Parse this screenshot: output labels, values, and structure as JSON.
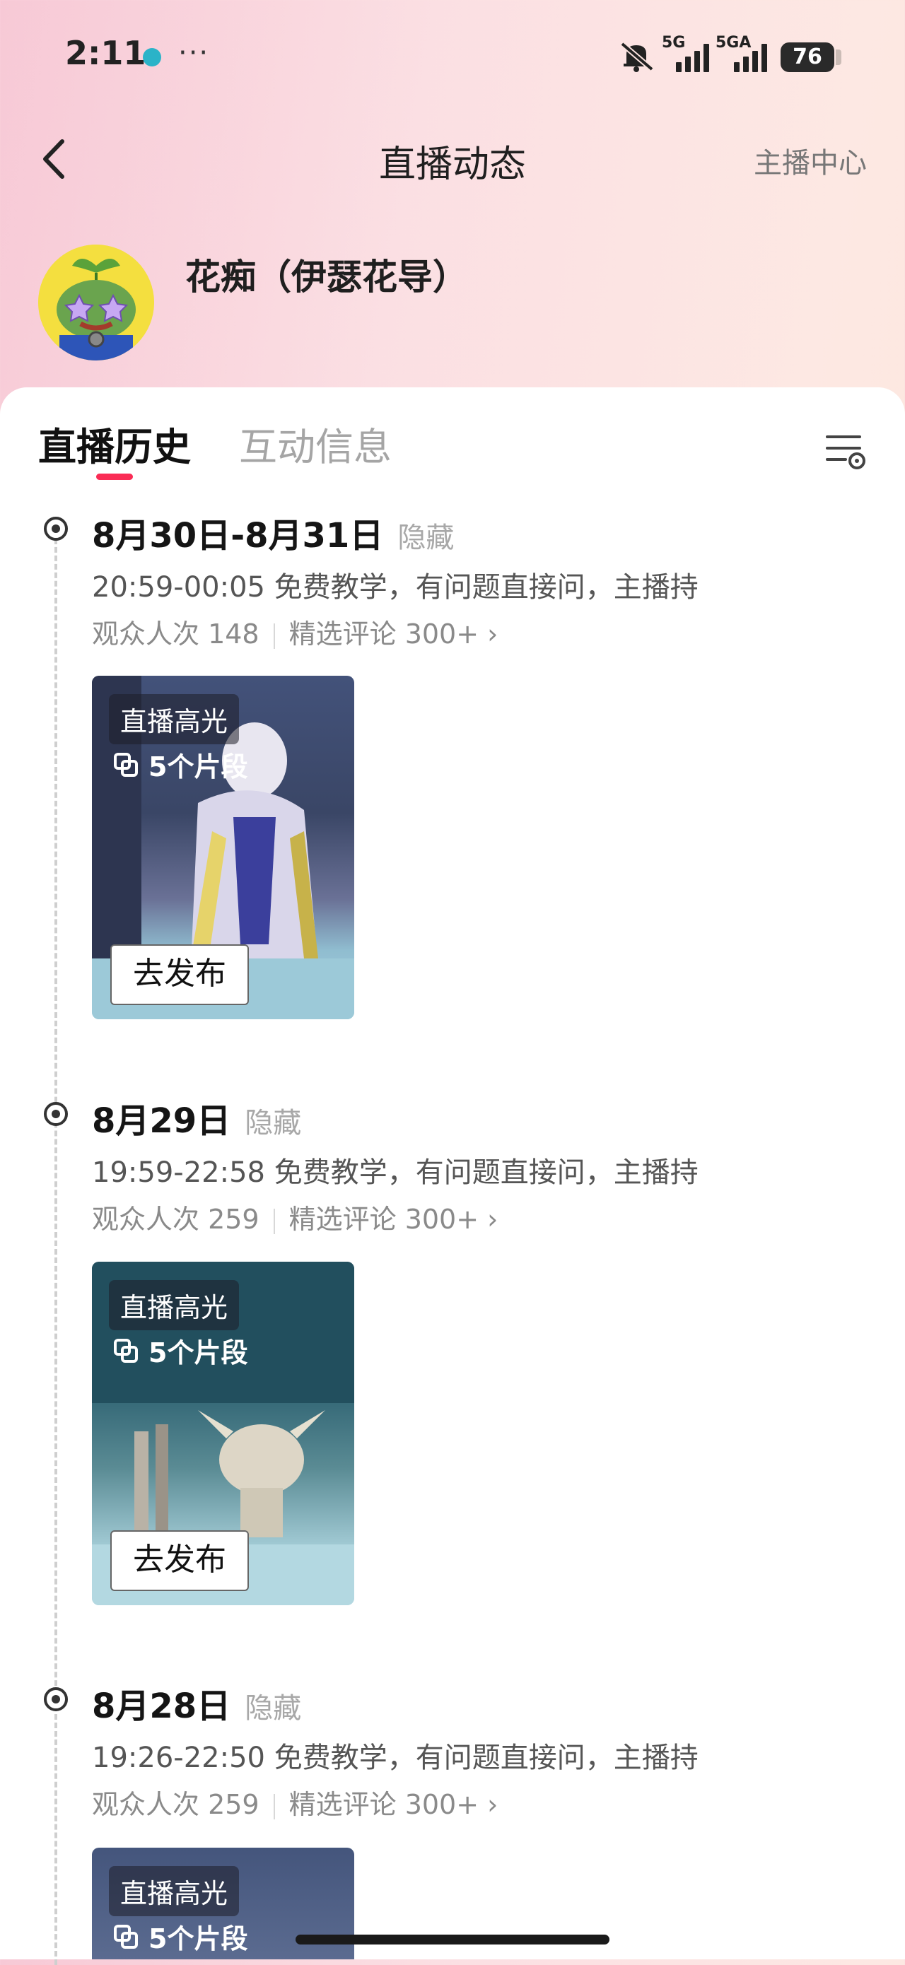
{
  "status_bar": {
    "time": "2:11",
    "more": "···",
    "network_1": "5G",
    "network_2": "5GA",
    "battery": "76",
    "icons": [
      "app-icon",
      "mute-icon",
      "signal-icon",
      "battery-icon"
    ]
  },
  "header": {
    "title": "直播动态",
    "right_link": "主播中心",
    "back_icon": "chevron-left-icon"
  },
  "anchor": {
    "name": "花痴（伊瑟花导）"
  },
  "tabs": [
    {
      "label": "直播历史",
      "active": true
    },
    {
      "label": "互动信息",
      "active": false
    }
  ],
  "accent_color": "#fa2c55",
  "items": [
    {
      "date": "8月30日-8月31日",
      "hidden": "隐藏",
      "desc": "20:59-00:05 免费教学，有问题直接问，主播持",
      "viewers": "观众人次 148",
      "comments": "精选评论 300+",
      "badge": "直播高光",
      "clips": "5个片段",
      "publish": "去发布"
    },
    {
      "date": "8月29日",
      "hidden": "隐藏",
      "desc": "19:59-22:58 免费教学，有问题直接问，主播持",
      "viewers": "观众人次 259",
      "comments": "精选评论 300+",
      "badge": "直播高光",
      "clips": "5个片段",
      "publish": "去发布"
    },
    {
      "date": "8月28日",
      "hidden": "隐藏",
      "desc": "19:26-22:50 免费教学，有问题直接问，主播持",
      "viewers": "观众人次 259",
      "comments": "精选评论 300+",
      "badge": "直播高光",
      "clips": "5个片段"
    }
  ]
}
